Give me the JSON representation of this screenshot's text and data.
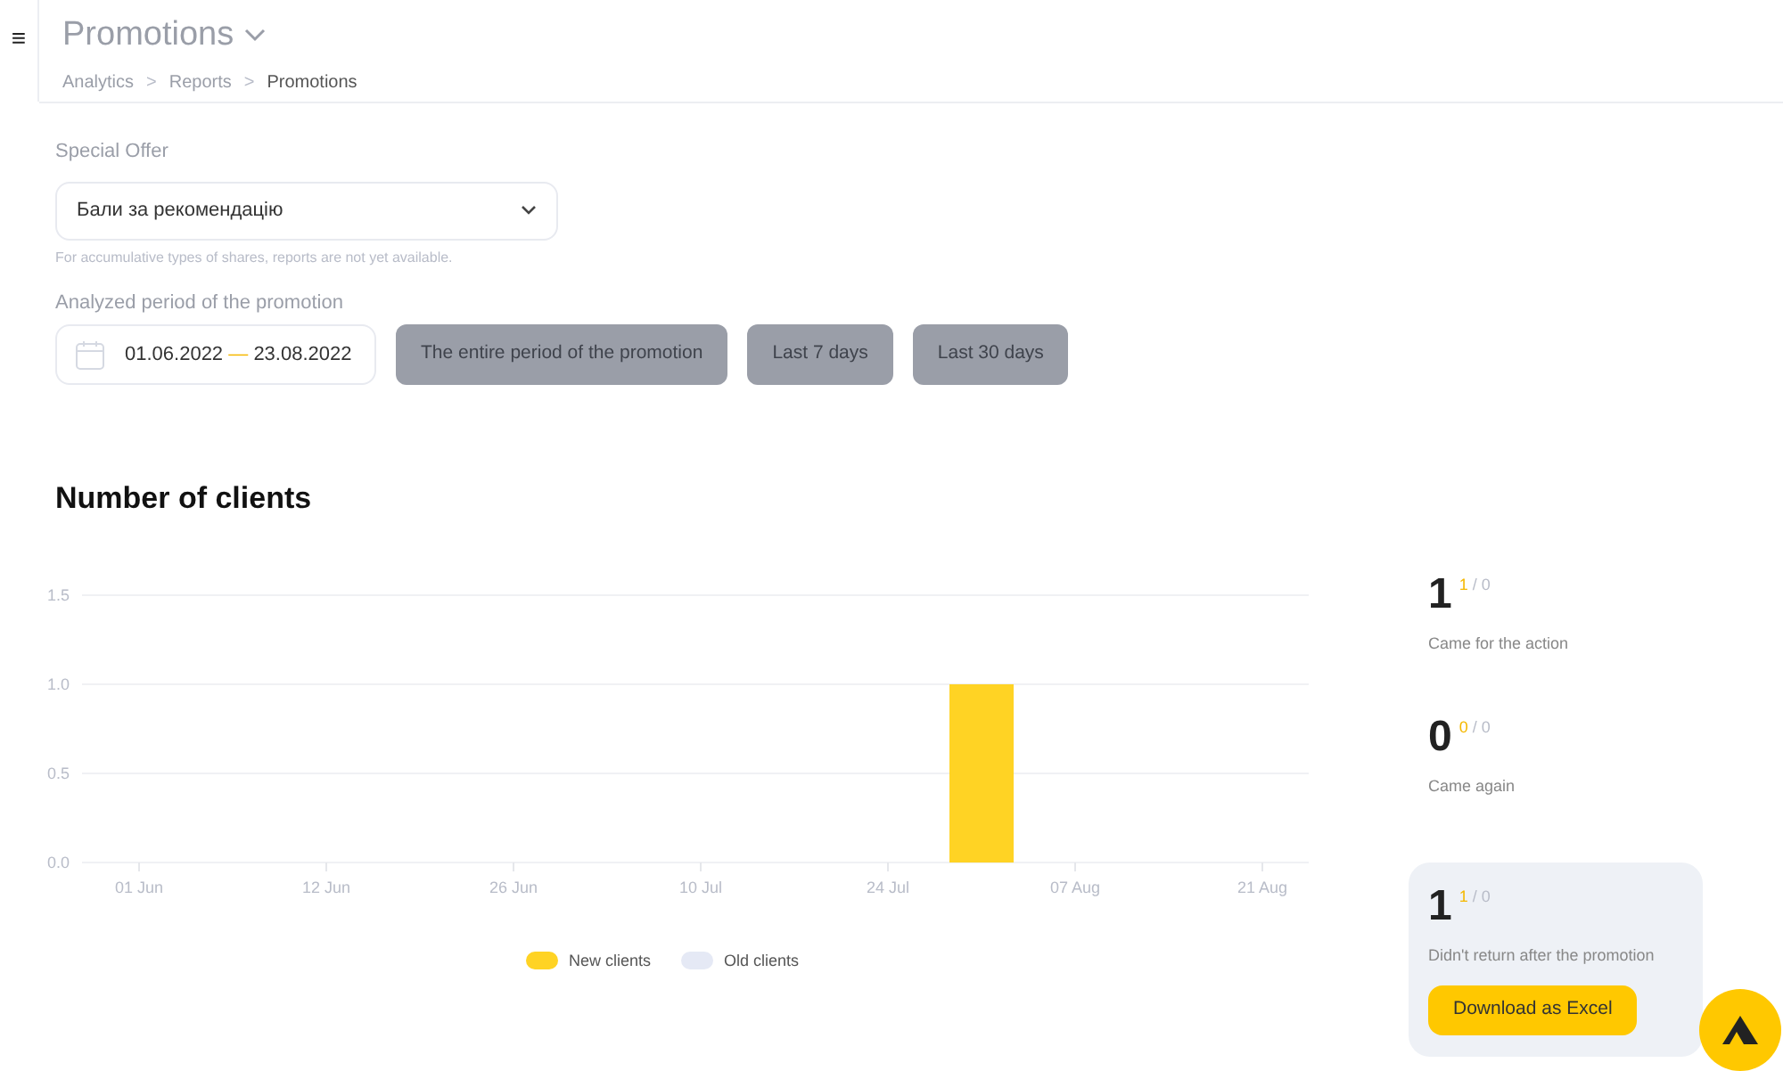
{
  "header": {
    "menu_icon": "≡",
    "title": "Promotions",
    "breadcrumbs": [
      "Analytics",
      "Reports",
      "Promotions"
    ],
    "separator": ">"
  },
  "special_offer": {
    "label": "Special Offer",
    "value": "Бали за рекомендацію",
    "hint": "For accumulative types of shares, reports are not yet available."
  },
  "period": {
    "label": "Analyzed period of the promotion",
    "start": "01.06.2022",
    "end": "23.08.2022",
    "dash": "—",
    "presets": [
      {
        "label": "The entire period of the promotion",
        "selected": false
      },
      {
        "label": "Last 7 days",
        "selected": false
      },
      {
        "label": "Last 30 days",
        "selected": false
      }
    ]
  },
  "chart_title": "Number of clients",
  "chart": {
    "chart_data": {
      "type": "bar",
      "categories": [
        "01 Jun",
        null,
        "12 Jun",
        null,
        "26 Jun",
        null,
        "10 Jul",
        null,
        "24 Jul",
        null,
        "07 Aug",
        null,
        "21 Aug"
      ],
      "ylim": [
        0,
        1.5
      ],
      "yticks": [
        {
          "value": 0,
          "label": "0.0"
        },
        {
          "value": 0.5,
          "label": "0.5"
        },
        {
          "value": 1,
          "label": "1.0"
        },
        {
          "value": 1.5,
          "label": "1.5"
        }
      ],
      "stacked": true,
      "series": [
        {
          "name": "New clients",
          "color": "#ffd324",
          "values": [
            0,
            0,
            0,
            0,
            0,
            0,
            0,
            0,
            0,
            1,
            0,
            0,
            0
          ]
        },
        {
          "name": "Old clients",
          "color": "#e5e9f5",
          "values": [
            0,
            0,
            0,
            0,
            0,
            0,
            0,
            0,
            0,
            0,
            0,
            0,
            0
          ]
        }
      ]
    }
  },
  "stats": [
    {
      "value": "1",
      "part": "1",
      "rest": "/ 0",
      "label": "Came for the action",
      "highlighted": false
    },
    {
      "value": "0",
      "part": "0",
      "rest": "/ 0",
      "label": "Came again",
      "highlighted": false
    },
    {
      "value": "1",
      "part": "1",
      "rest": "/ 0",
      "label": "Didn't return after the promotion",
      "highlighted": true,
      "button": "Download as Excel"
    }
  ]
}
